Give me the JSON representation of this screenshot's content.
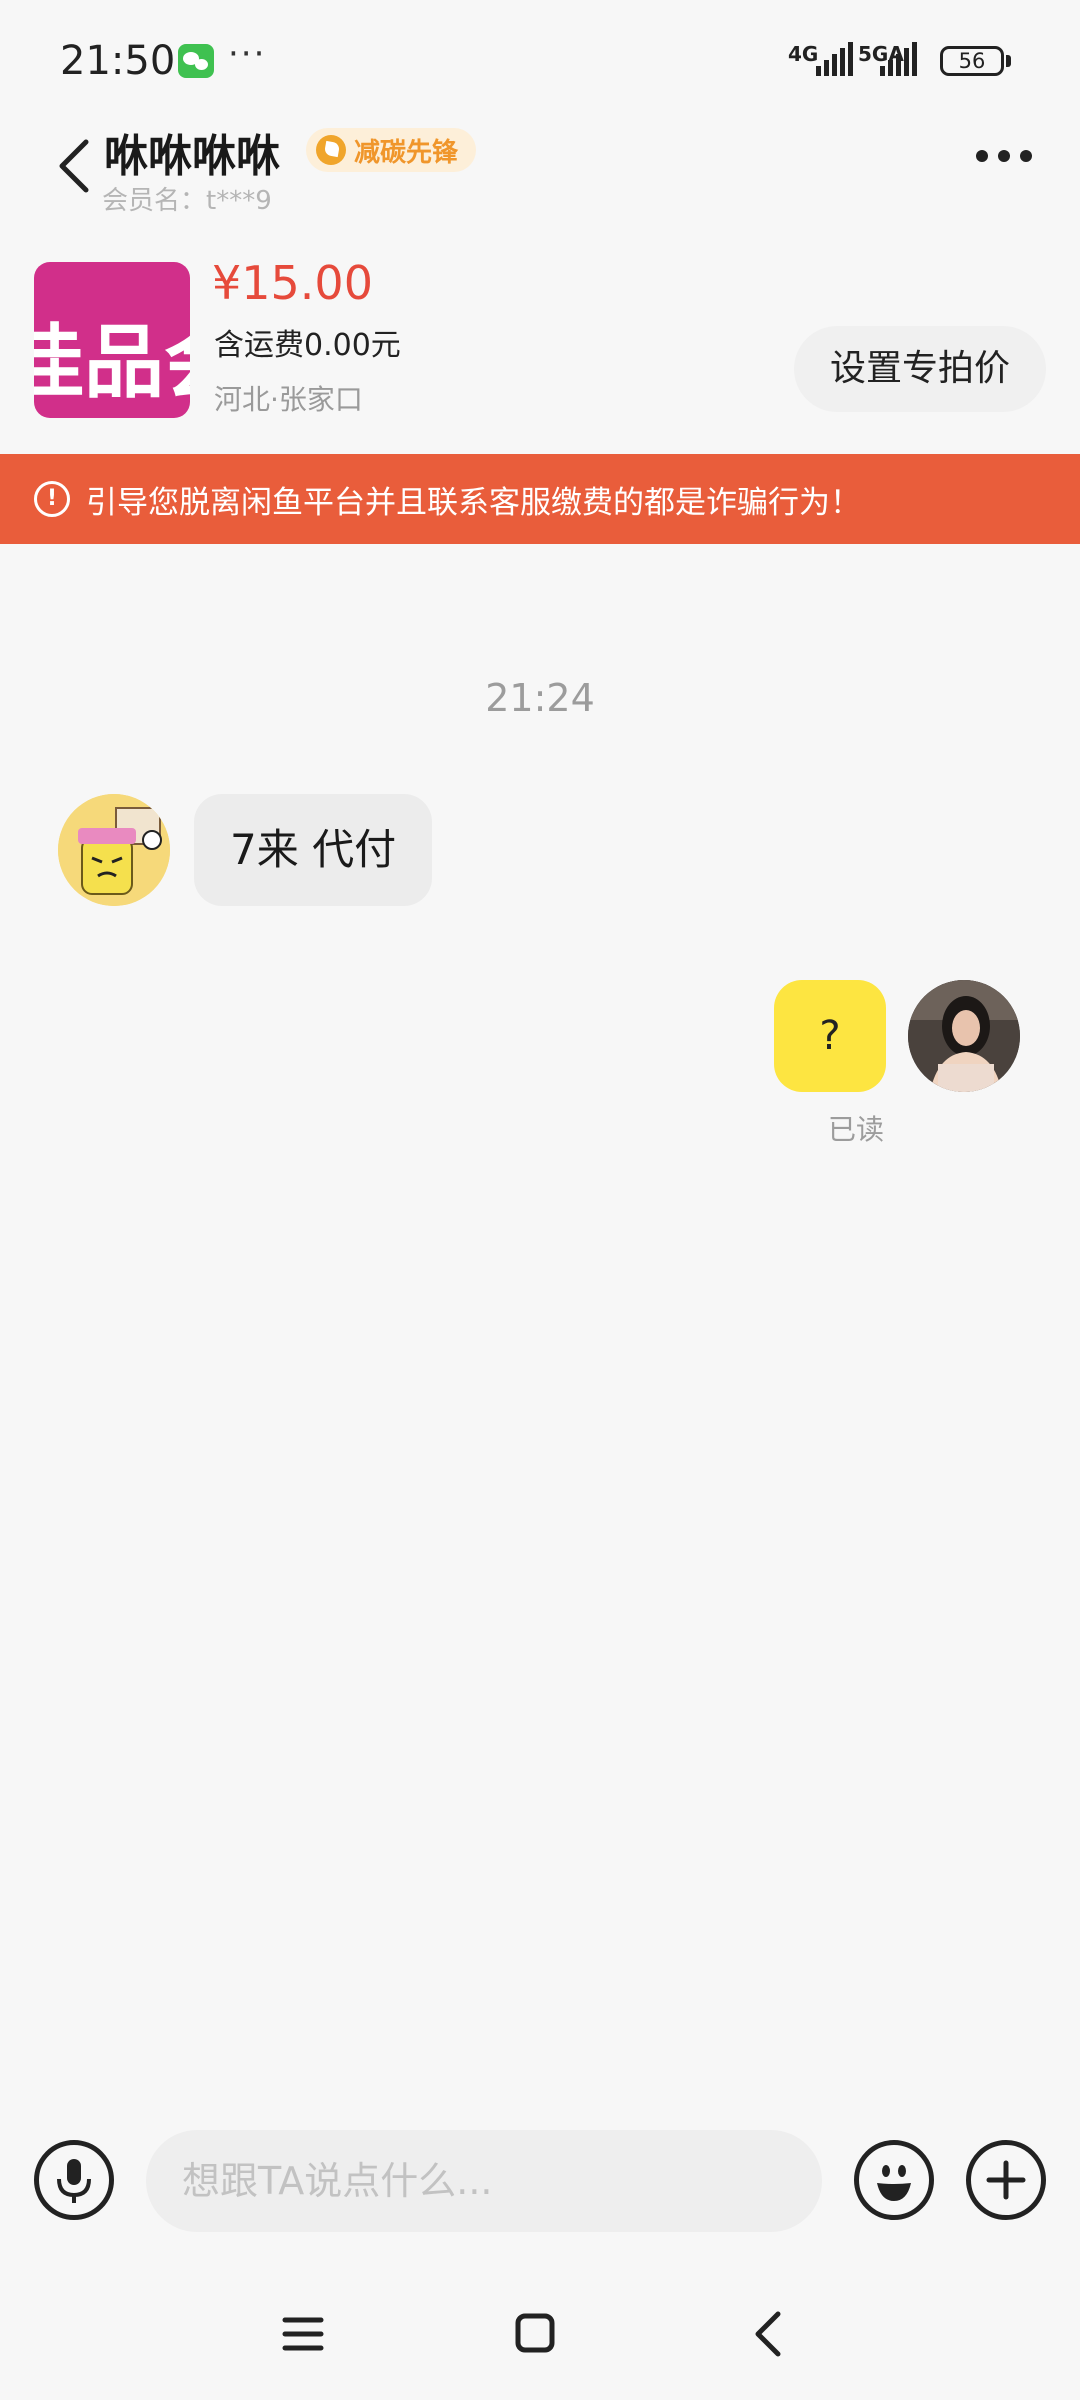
{
  "status_bar": {
    "time": "21:50",
    "more": "···",
    "network_1": "4G",
    "network_2": "5GA",
    "battery": "56",
    "app_icon": "wechat-icon"
  },
  "header": {
    "title": "咻咻咻咻",
    "badge": "减碳先锋",
    "member_name": "会员名：t***9"
  },
  "product": {
    "thumb_text": "佳品会",
    "price": "¥15.00",
    "shipping": "含运费0.00元",
    "location": "河北·张家口",
    "set_price_label": "设置专拍价"
  },
  "warning": {
    "text": "引导您脱离闲鱼平台并且联系客服缴费的都是诈骗行为！"
  },
  "messages": {
    "time": "21:24",
    "incoming_text": "7来 代付",
    "outgoing_text": "?",
    "read_status": "已读"
  },
  "input_bar": {
    "placeholder": "想跟TA说点什么..."
  },
  "colors": {
    "accent_price": "#e64a3b",
    "warning_bg": "#e95d3b",
    "outgoing_bubble": "#fde541",
    "badge_text": "#f0962b"
  }
}
